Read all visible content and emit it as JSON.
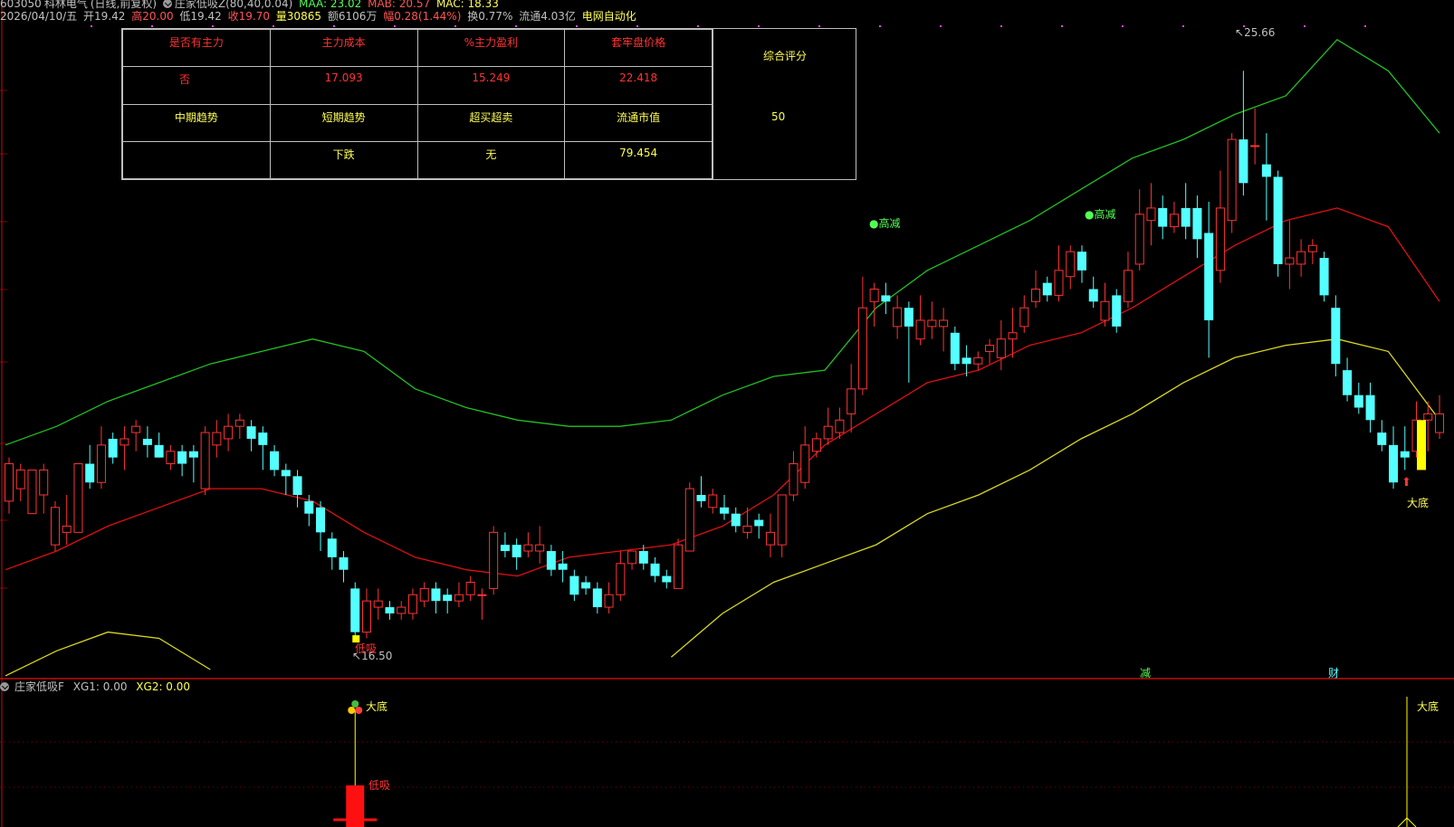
{
  "header": {
    "stock_code": "603050",
    "stock_name": "科林电气",
    "period": "(日线,前复权)",
    "indicator_name": "庄家低吸Z(80,40,0.04)",
    "maa": "MAA: 23.02",
    "mab": "MAB: 20.57",
    "mac": "MAC: 18.33",
    "date": "2026/04/10/五",
    "open": "开19.42",
    "high": "高20.00",
    "low": "低19.42",
    "close": "收19.70",
    "volume": "量30865",
    "amount": "额6106万",
    "change": "幅0.28(1.44%)",
    "turnover": "换0.77%",
    "float_value": "流通4.03亿",
    "sector": "电网自动化"
  },
  "info_table": {
    "headers": [
      "是否有主力",
      "主力成本",
      "%主力盈利",
      "套牢盘价格"
    ],
    "row1": [
      "否",
      "17.093",
      "15.249",
      "22.418"
    ],
    "headers2": [
      "中期趋势",
      "短期趋势",
      "超买超卖",
      "流通市值"
    ],
    "row2": [
      "",
      "下跌",
      "无",
      "79.454"
    ],
    "score_label": "综合评分",
    "score_value": "50"
  },
  "annotations": {
    "high_price": "25.66",
    "low_price": "16.50",
    "signal_high_reduce": "高减",
    "signal_low_buy": "低吸",
    "signal_big_bottom": "大底",
    "marker_reduce": "减",
    "marker_finance": "财"
  },
  "lower_panel": {
    "name": "庄家低吸F",
    "xg1": "XG1: 0.00",
    "xg2": "XG2: 0.00",
    "label_big_bottom": "大底",
    "label_low_buy": "低吸"
  },
  "colors": {
    "up": "#ff3333",
    "down": "#54ffff",
    "green_band": "#22c022",
    "red_band": "#e01010",
    "yellow_band": "#d8d820",
    "grid_red": "#800000"
  },
  "chart_data": {
    "type": "candlestick",
    "price_range": [
      16.0,
      26.3
    ],
    "candles": [
      [
        18.7,
        19.3,
        18.5,
        19.4
      ],
      [
        18.9,
        19.2,
        18.7,
        19.3
      ],
      [
        18.5,
        19.2,
        18.6,
        18.6
      ],
      [
        18.8,
        19.2,
        18.5,
        19.3
      ],
      [
        18.0,
        18.6,
        17.9,
        18.7
      ],
      [
        18.2,
        18.3,
        18.0,
        18.8
      ],
      [
        18.2,
        19.3,
        18.2,
        19.3
      ],
      [
        19.3,
        19.0,
        18.9,
        19.6
      ],
      [
        19.0,
        19.6,
        18.9,
        19.9
      ],
      [
        19.7,
        19.4,
        19.3,
        19.8
      ],
      [
        19.6,
        19.7,
        19.2,
        19.9
      ],
      [
        19.8,
        19.9,
        19.5,
        20.0
      ],
      [
        19.7,
        19.6,
        19.4,
        19.9
      ],
      [
        19.6,
        19.4,
        19.4,
        19.8
      ],
      [
        19.3,
        19.5,
        19.2,
        19.6
      ],
      [
        19.5,
        19.3,
        19.1,
        19.6
      ],
      [
        19.5,
        19.4,
        19.0,
        19.6
      ],
      [
        18.9,
        19.8,
        18.8,
        19.9
      ],
      [
        19.6,
        19.8,
        19.4,
        20.0
      ],
      [
        19.7,
        19.9,
        19.5,
        20.1
      ],
      [
        19.9,
        20.0,
        19.7,
        20.1
      ],
      [
        19.9,
        19.7,
        19.5,
        20.0
      ],
      [
        19.8,
        19.6,
        19.2,
        19.9
      ],
      [
        19.5,
        19.2,
        19.1,
        19.6
      ],
      [
        19.2,
        19.1,
        18.8,
        19.3
      ],
      [
        19.1,
        18.8,
        18.6,
        19.2
      ],
      [
        18.7,
        18.5,
        18.3,
        18.8
      ],
      [
        18.6,
        18.2,
        17.9,
        18.7
      ],
      [
        18.1,
        17.8,
        17.6,
        18.2
      ],
      [
        17.8,
        17.6,
        17.4,
        17.9
      ],
      [
        17.3,
        16.6,
        16.5,
        17.4
      ],
      [
        16.6,
        17.1,
        16.5,
        17.3
      ],
      [
        17.0,
        17.1,
        16.8,
        17.3
      ],
      [
        17.0,
        16.9,
        16.8,
        17.1
      ],
      [
        16.9,
        17.0,
        16.8,
        17.1
      ],
      [
        16.9,
        17.2,
        16.8,
        17.3
      ],
      [
        17.1,
        17.3,
        17.0,
        17.4
      ],
      [
        17.3,
        17.1,
        16.9,
        17.4
      ],
      [
        17.2,
        17.1,
        16.9,
        17.3
      ],
      [
        17.1,
        17.2,
        17.0,
        17.4
      ],
      [
        17.2,
        17.4,
        17.1,
        17.5
      ],
      [
        17.2,
        17.2,
        16.8,
        17.3
      ],
      [
        17.3,
        18.2,
        17.2,
        18.3
      ],
      [
        18.0,
        17.9,
        17.8,
        18.2
      ],
      [
        18.0,
        17.8,
        17.6,
        18.1
      ],
      [
        17.9,
        18.0,
        17.8,
        18.2
      ],
      [
        17.9,
        18.0,
        17.7,
        18.3
      ],
      [
        17.9,
        17.6,
        17.5,
        18.0
      ],
      [
        17.7,
        17.6,
        17.4,
        17.9
      ],
      [
        17.5,
        17.2,
        17.1,
        17.6
      ],
      [
        17.4,
        17.3,
        17.2,
        17.5
      ],
      [
        17.3,
        17.0,
        16.9,
        17.4
      ],
      [
        17.0,
        17.2,
        16.9,
        17.4
      ],
      [
        17.2,
        17.7,
        17.1,
        17.9
      ],
      [
        17.7,
        17.9,
        17.6,
        17.9
      ],
      [
        17.9,
        17.7,
        17.6,
        18.0
      ],
      [
        17.7,
        17.5,
        17.4,
        17.8
      ],
      [
        17.5,
        17.4,
        17.3,
        17.6
      ],
      [
        17.3,
        18.0,
        17.3,
        18.1
      ],
      [
        17.9,
        18.9,
        17.9,
        19.0
      ],
      [
        18.8,
        18.7,
        18.6,
        19.1
      ],
      [
        18.6,
        18.8,
        18.5,
        18.9
      ],
      [
        18.6,
        18.5,
        18.4,
        18.8
      ],
      [
        18.5,
        18.3,
        18.2,
        18.6
      ],
      [
        18.2,
        18.3,
        18.1,
        18.6
      ],
      [
        18.4,
        18.3,
        18.1,
        18.5
      ],
      [
        18.0,
        18.2,
        17.8,
        18.5
      ],
      [
        18.0,
        18.8,
        17.8,
        18.8
      ],
      [
        18.8,
        19.3,
        18.7,
        19.5
      ],
      [
        19.0,
        19.6,
        18.9,
        19.9
      ],
      [
        19.5,
        19.7,
        19.4,
        19.8
      ],
      [
        19.7,
        19.9,
        19.6,
        20.2
      ],
      [
        19.8,
        20.0,
        19.7,
        20.2
      ],
      [
        20.1,
        20.5,
        19.8,
        20.9
      ],
      [
        20.5,
        21.8,
        20.4,
        22.3
      ],
      [
        21.9,
        22.1,
        21.5,
        22.2
      ],
      [
        22.0,
        21.9,
        21.7,
        22.2
      ],
      [
        21.5,
        21.8,
        21.3,
        22.0
      ],
      [
        21.8,
        21.5,
        20.6,
        21.9
      ],
      [
        21.3,
        21.6,
        21.2,
        22.0
      ],
      [
        21.5,
        21.6,
        21.3,
        21.9
      ],
      [
        21.5,
        21.6,
        21.1,
        21.8
      ],
      [
        21.4,
        20.9,
        20.8,
        21.5
      ],
      [
        21.0,
        20.9,
        20.7,
        21.2
      ],
      [
        20.9,
        21.0,
        20.8,
        21.1
      ],
      [
        21.1,
        21.2,
        20.9,
        21.3
      ],
      [
        21.0,
        21.3,
        20.8,
        21.6
      ],
      [
        21.3,
        21.4,
        21.0,
        21.8
      ],
      [
        21.5,
        21.8,
        21.4,
        22.0
      ],
      [
        21.9,
        22.1,
        21.8,
        22.4
      ],
      [
        22.2,
        22.0,
        21.9,
        22.3
      ],
      [
        22.0,
        22.4,
        21.9,
        22.8
      ],
      [
        22.3,
        22.7,
        22.1,
        22.8
      ],
      [
        22.7,
        22.4,
        22.2,
        22.8
      ],
      [
        22.1,
        21.9,
        21.8,
        22.3
      ],
      [
        21.6,
        21.9,
        21.5,
        22.2
      ],
      [
        22.0,
        21.5,
        21.4,
        22.1
      ],
      [
        21.9,
        22.4,
        21.8,
        22.7
      ],
      [
        22.5,
        23.3,
        22.4,
        23.7
      ],
      [
        23.2,
        23.4,
        22.8,
        23.8
      ],
      [
        23.4,
        23.1,
        22.9,
        23.6
      ],
      [
        23.1,
        23.3,
        23.0,
        23.5
      ],
      [
        23.4,
        23.1,
        22.9,
        23.8
      ],
      [
        23.4,
        22.9,
        22.6,
        23.6
      ],
      [
        23.0,
        21.6,
        21.0,
        23.5
      ],
      [
        22.4,
        23.4,
        22.2,
        24.0
      ],
      [
        23.2,
        24.5,
        23.0,
        24.6
      ],
      [
        24.5,
        23.8,
        23.6,
        25.6
      ],
      [
        24.4,
        24.4,
        24.1,
        25.0
      ],
      [
        24.1,
        23.9,
        23.2,
        24.6
      ],
      [
        23.9,
        22.5,
        22.3,
        24.0
      ],
      [
        22.5,
        22.6,
        22.1,
        23.2
      ],
      [
        22.5,
        22.7,
        22.3,
        22.9
      ],
      [
        22.7,
        22.8,
        22.5,
        22.9
      ],
      [
        22.6,
        22.0,
        21.9,
        22.7
      ],
      [
        21.8,
        20.9,
        20.7,
        22.0
      ],
      [
        20.8,
        20.4,
        20.3,
        21.0
      ],
      [
        20.4,
        20.2,
        20.1,
        20.6
      ],
      [
        20.4,
        20.0,
        19.8,
        20.6
      ],
      [
        19.8,
        19.6,
        19.5,
        20.0
      ],
      [
        19.6,
        19.0,
        18.9,
        19.9
      ],
      [
        19.5,
        19.4,
        19.2,
        19.9
      ],
      [
        19.5,
        20.0,
        19.4,
        20.3
      ],
      [
        20.0,
        20.1,
        19.5,
        20.3
      ],
      [
        19.8,
        20.1,
        19.7,
        20.4
      ]
    ],
    "band_upper": [
      19.6,
      19.9,
      20.3,
      20.6,
      20.9,
      21.1,
      21.3,
      21.1,
      20.5,
      20.2,
      20.0,
      19.9,
      19.9,
      20.0,
      20.4,
      20.7,
      20.8,
      21.8,
      22.4,
      22.8,
      23.2,
      23.7,
      24.2,
      24.5,
      24.9,
      25.2,
      26.1,
      25.6,
      24.6
    ],
    "band_mid": [
      17.6,
      17.9,
      18.3,
      18.6,
      18.9,
      18.9,
      18.7,
      18.2,
      17.8,
      17.6,
      17.5,
      17.8,
      17.9,
      18.0,
      18.3,
      18.8,
      19.6,
      20.1,
      20.6,
      20.8,
      21.2,
      21.4,
      21.8,
      22.3,
      22.8,
      23.2,
      23.4,
      23.1,
      21.9
    ],
    "band_lower": [
      15.9,
      16.3,
      16.6,
      16.5,
      16.0,
      null,
      null,
      null,
      null,
      null,
      null,
      null,
      null,
      16.2,
      16.9,
      17.4,
      17.7,
      18.0,
      18.5,
      18.8,
      19.2,
      19.7,
      20.1,
      20.6,
      21.0,
      21.2,
      21.3,
      21.1,
      20.0
    ]
  }
}
